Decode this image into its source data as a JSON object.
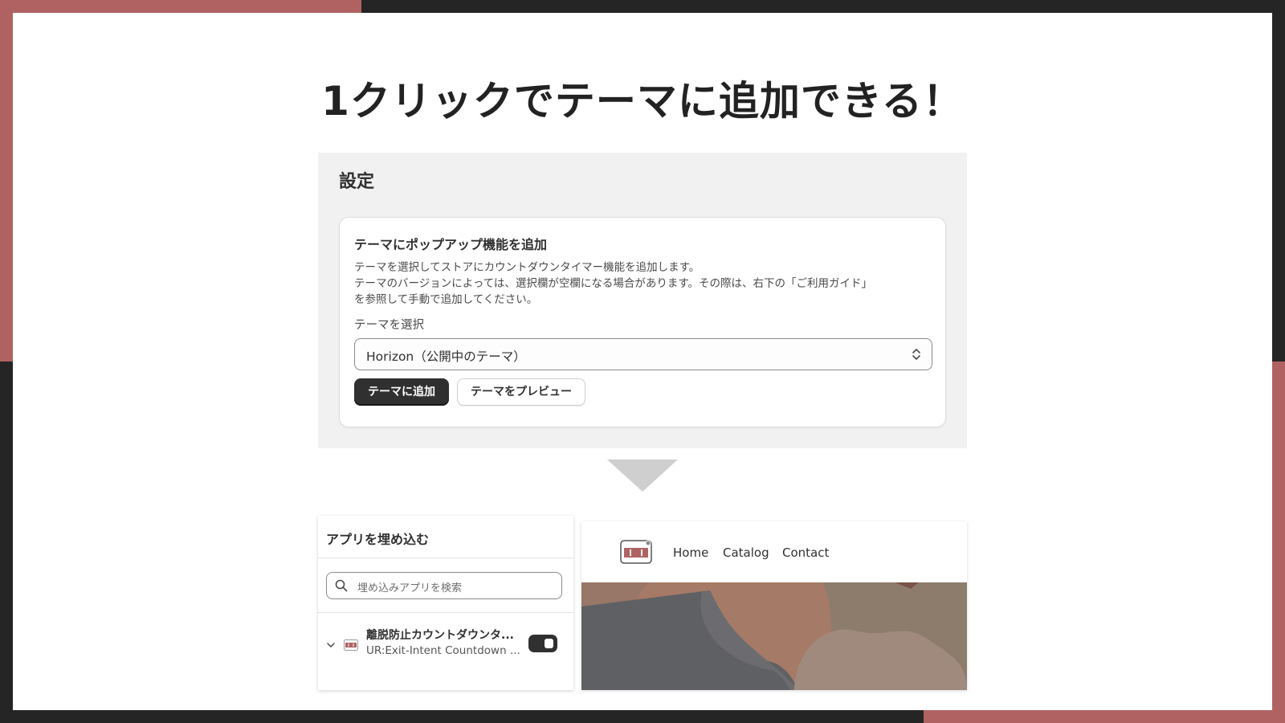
{
  "colors": {
    "accent": "#b06262",
    "frame": "#252525",
    "primary_button": "#303030"
  },
  "slide": {
    "title": "1クリックでテーマに追加できる！"
  },
  "settings": {
    "heading": "設定",
    "card": {
      "title": "テーマにポップアップ機能を追加",
      "description_lines": [
        "テーマを選択してストアにカウントダウンタイマー機能を追加します。",
        "テーマのバージョンによっては、選択欄が空欄になる場合があります。その際は、右下の「ご利用ガイド」",
        "を参照して手動で追加してください。"
      ],
      "select_label": "テーマを選択",
      "select_value": "Horizon（公開中のテーマ）",
      "add_button": "テーマに追加",
      "preview_button": "テーマをプレビュー"
    }
  },
  "embed": {
    "title": "アプリを埋め込む",
    "search_placeholder": "埋め込みアプリを検索",
    "app": {
      "name": "離脱防止カウントダウンタ...",
      "subtitle": "UR:Exit-Intent Countdown ...",
      "enabled": true
    }
  },
  "store_preview": {
    "nav": [
      "Home",
      "Catalog",
      "Contact"
    ]
  },
  "icons": {
    "select_caret": "chevron-up-down-icon",
    "search": "search-icon",
    "expand": "chevron-down-icon",
    "down_arrow": "triangle-down-icon"
  }
}
